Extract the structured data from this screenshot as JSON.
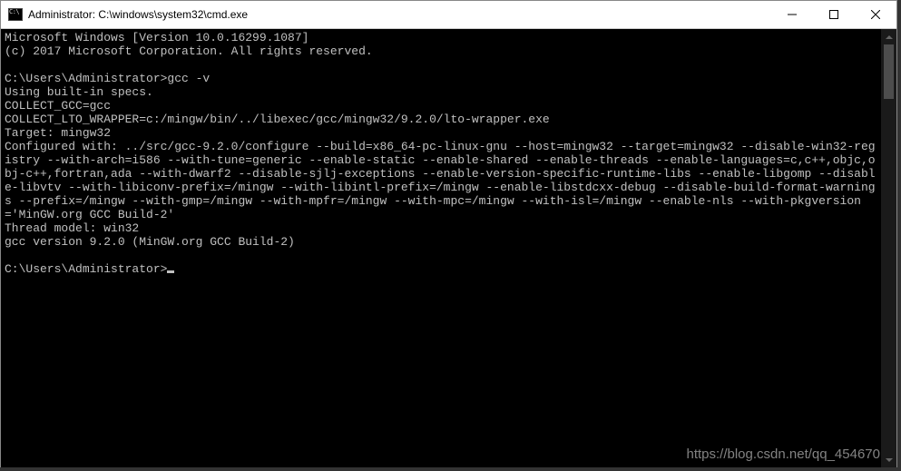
{
  "window": {
    "title": "Administrator: C:\\windows\\system32\\cmd.exe"
  },
  "terminal": {
    "lines": [
      "Microsoft Windows [Version 10.0.16299.1087]",
      "(c) 2017 Microsoft Corporation. All rights reserved.",
      "",
      "C:\\Users\\Administrator>gcc -v",
      "Using built-in specs.",
      "COLLECT_GCC=gcc",
      "COLLECT_LTO_WRAPPER=c:/mingw/bin/../libexec/gcc/mingw32/9.2.0/lto-wrapper.exe",
      "Target: mingw32",
      "Configured with: ../src/gcc-9.2.0/configure --build=x86_64-pc-linux-gnu --host=mingw32 --target=mingw32 --disable-win32-registry --with-arch=i586 --with-tune=generic --enable-static --enable-shared --enable-threads --enable-languages=c,c++,objc,obj-c++,fortran,ada --with-dwarf2 --disable-sjlj-exceptions --enable-version-specific-runtime-libs --enable-libgomp --disable-libvtv --with-libiconv-prefix=/mingw --with-libintl-prefix=/mingw --enable-libstdcxx-debug --disable-build-format-warnings --prefix=/mingw --with-gmp=/mingw --with-mpfr=/mingw --with-mpc=/mingw --with-isl=/mingw --enable-nls --with-pkgversion='MinGW.org GCC Build-2'",
      "Thread model: win32",
      "gcc version 9.2.0 (MinGW.org GCC Build-2)",
      ""
    ],
    "prompt": "C:\\Users\\Administrator>"
  },
  "watermark": "https://blog.csdn.net/qq_454670"
}
